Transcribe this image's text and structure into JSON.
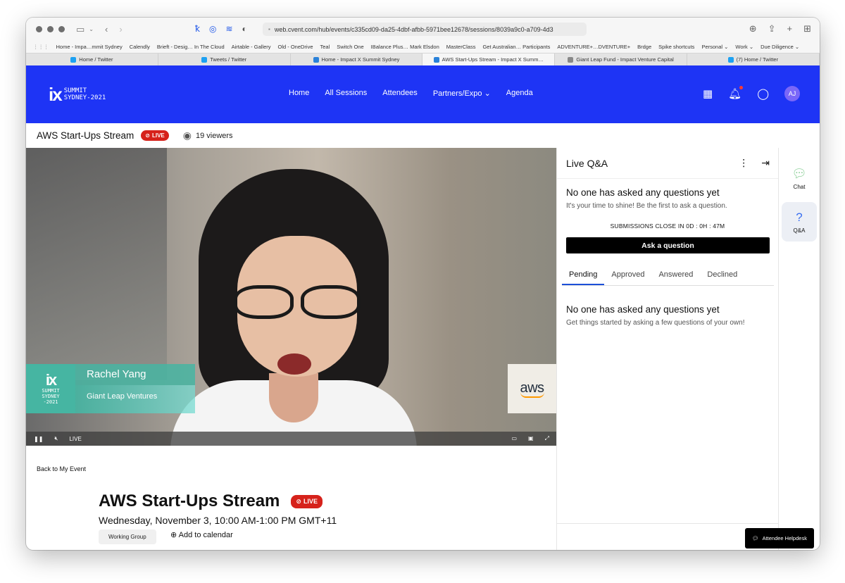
{
  "browser": {
    "url": "web.cvent.com/hub/events/c335cd09-da25-4dbf-afbb-5971bee12678/sessions/8039a9c0-a709-4d3",
    "bookmarks": [
      "Home - Impa…mmit Sydney",
      "Calendly",
      "Brieft - Desig… In The Cloud",
      "Airtable - Gallery",
      "Old - OneDrive",
      "Teal",
      "Switch One",
      "IBalance Plus… Mark Elsdon",
      "MasterClass",
      "Get Australian… Participants",
      "ADVENTURE+…DVENTURE+",
      "Brdge",
      "Spike shortcuts",
      "Personal ⌄",
      "Work ⌄",
      "Due Diligence ⌄"
    ],
    "tabs": [
      {
        "label": "Home / Twitter",
        "color": "#1da1f2"
      },
      {
        "label": "Tweets / Twitter",
        "color": "#1da1f2"
      },
      {
        "label": "Home - Impact X Summit Sydney",
        "color": "#2b82d9"
      },
      {
        "label": "AWS Start-Ups Stream - Impact X Summ…",
        "color": "#2b82d9"
      },
      {
        "label": "Giant Leap Fund - Impact Venture Capital",
        "color": "#888888"
      },
      {
        "label": "(7) Home / Twitter",
        "color": "#1da1f2"
      }
    ]
  },
  "header": {
    "logo_mark": "ix",
    "logo_line1": "SUMMIT",
    "logo_line2": "SYDNEY-2021",
    "nav": [
      "Home",
      "All Sessions",
      "Attendees",
      "Partners/Expo ⌄",
      "Agenda"
    ],
    "avatar_initials": "AJ",
    "accent_color": "#1e34f5"
  },
  "session": {
    "title": "AWS Start-Ups Stream",
    "live_label": "LIVE",
    "viewers": "19 viewers"
  },
  "video": {
    "speaker_name": "Rachel Yang",
    "speaker_company": "Giant Leap Ventures",
    "lt_logo_mark": "ix",
    "lt_logo_line1": "SUMMIT",
    "lt_logo_line2": "SYDNEY",
    "lt_logo_line3": "-2021",
    "sponsor": "aws",
    "live_indicator": "LIVE"
  },
  "details": {
    "back_link": "Back to My Event",
    "title": "AWS Start-Ups Stream",
    "live_label": "LIVE",
    "date": "Wednesday, November 3, 10:00 AM-1:00 PM GMT+11",
    "tag": "Working Group",
    "add_calendar": "Add to calendar"
  },
  "qa": {
    "title": "Live Q&A",
    "empty_title": "No one has asked any questions yet",
    "empty_sub": "It's your time to shine! Be the first to ask a question.",
    "submissions_close": "SUBMISSIONS CLOSE IN 0D : 0H : 47M",
    "ask_button": "Ask a question",
    "tabs": [
      "Pending",
      "Approved",
      "Answered",
      "Declined"
    ],
    "empty2_title": "No one has asked any questions yet",
    "empty2_sub": "Get things started by asking a few questions of your own!"
  },
  "rail": {
    "chat": "Chat",
    "qa": "Q&A"
  },
  "helpdesk": "Attendee Helpdesk"
}
